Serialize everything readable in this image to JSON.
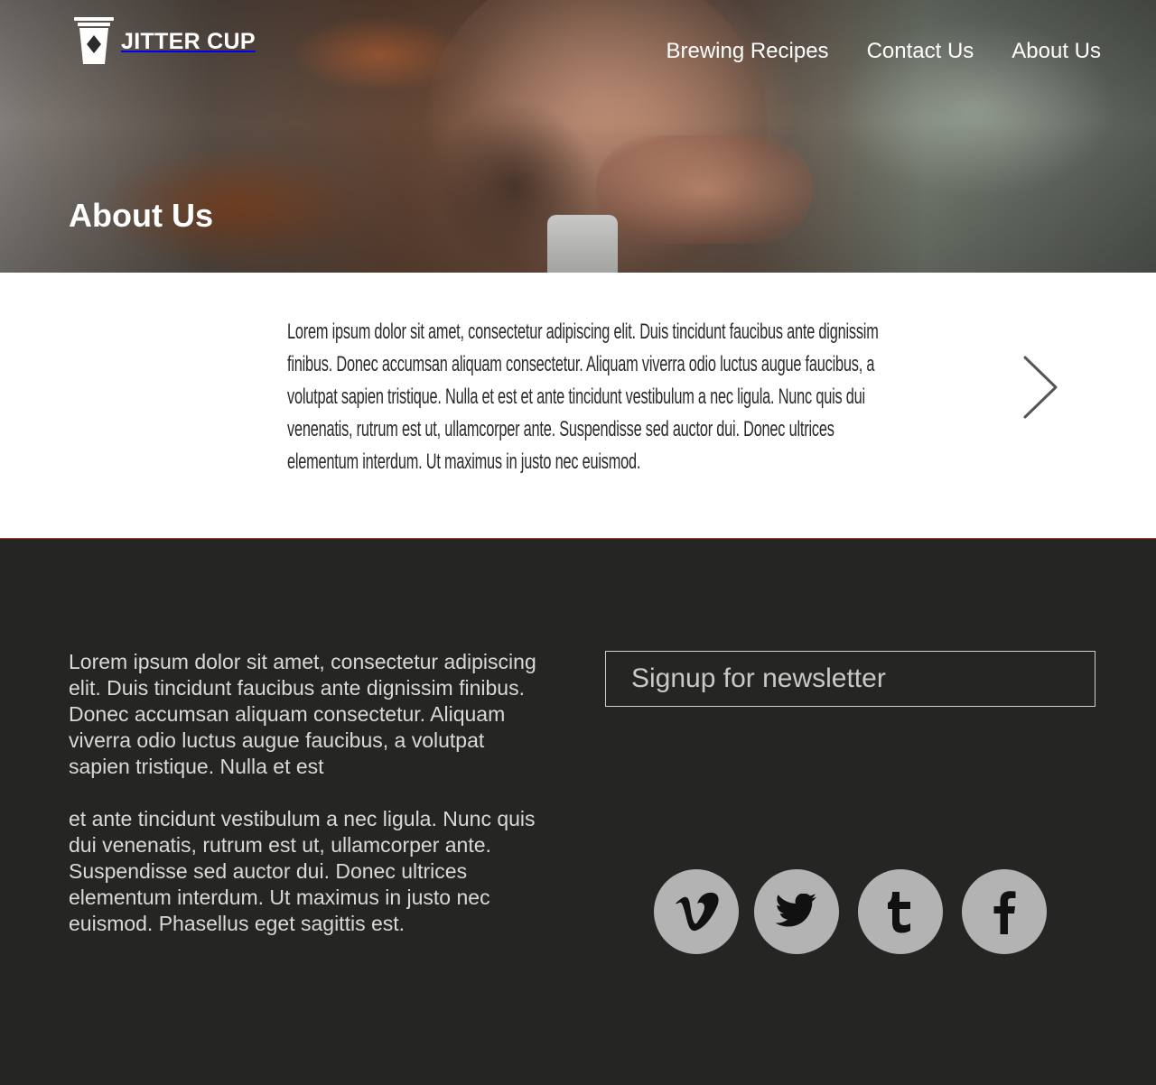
{
  "brand": {
    "name": "JITTER CUP",
    "logo_icon": "coffee-cup-icon"
  },
  "nav": {
    "items": [
      {
        "label": "Brewing Recipes"
      },
      {
        "label": "Contact Us"
      },
      {
        "label": "About Us"
      }
    ]
  },
  "hero": {
    "title": "About Us"
  },
  "content": {
    "paragraph": "Lorem ipsum dolor sit amet, consectetur adipiscing elit. Duis tincidunt faucibus ante dignissim finibus. Donec accumsan aliquam consectetur. Aliquam viverra odio luctus augue faucibus, a volutpat sapien tristique. Nulla et est et ante tincidunt vestibulum a nec ligula. Nunc quis dui venenatis, rutrum est ut, ullamcorper ante. Suspendisse sed auctor dui. Donec ultrices elementum interdum. Ut maximus in justo nec euismod.",
    "next_icon": "chevron-right-icon"
  },
  "footer": {
    "paragraphs": [
      "Lorem ipsum dolor sit amet, consectetur adipiscing elit. Duis tincidunt faucibus ante dignissim finibus. Donec accumsan aliquam consectetur. Aliquam viverra odio luctus augue faucibus, a volutpat sapien tristique. Nulla et est",
      "et ante tincidunt vestibulum a nec ligula. Nunc quis dui venenatis, rutrum est ut, ullamcorper ante. Suspendisse sed auctor dui. Donec ultrices elementum interdum. Ut maximus in justo nec euismod. Phasellus eget sagittis est."
    ],
    "newsletter": {
      "placeholder": "Signup for newsletter"
    },
    "social": [
      {
        "name": "vimeo-icon"
      },
      {
        "name": "twitter-icon"
      },
      {
        "name": "tumblr-icon"
      },
      {
        "name": "facebook-icon"
      }
    ]
  },
  "colors": {
    "footer_bg": "#252523",
    "footer_border": "#b0372f",
    "social_bg": "#b3b3b3",
    "social_glyph": "#111111"
  }
}
